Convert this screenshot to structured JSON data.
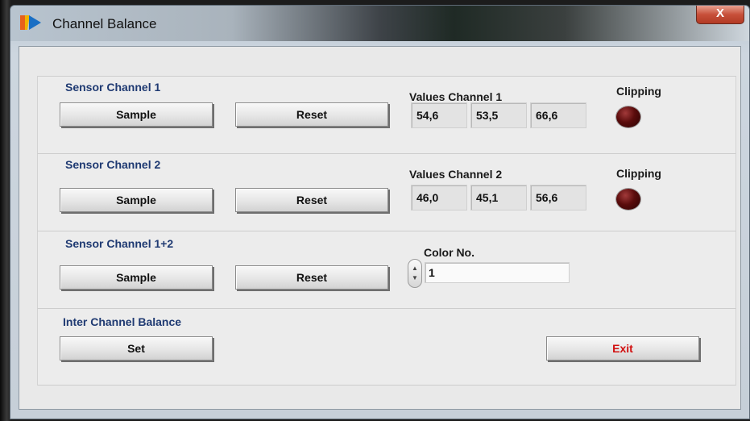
{
  "window": {
    "title": "Channel Balance",
    "close_label": "X"
  },
  "groups": {
    "channel1": {
      "title": "Sensor Channel 1",
      "sample_label": "Sample",
      "reset_label": "Reset",
      "values_label": "Values Channel 1",
      "values": [
        "54,6",
        "53,5",
        "66,6"
      ],
      "clipping_label": "Clipping"
    },
    "channel2": {
      "title": "Sensor Channel 2",
      "sample_label": "Sample",
      "reset_label": "Reset",
      "values_label": "Values Channel 2",
      "values": [
        "46,0",
        "45,1",
        "56,6"
      ],
      "clipping_label": "Clipping"
    },
    "channel12": {
      "title": "Sensor Channel 1+2",
      "sample_label": "Sample",
      "reset_label": "Reset",
      "color_label": "Color No.",
      "color_value": "1"
    },
    "inter": {
      "title": "Inter Channel Balance",
      "set_label": "Set",
      "exit_label": "Exit"
    }
  },
  "colors": {
    "group_title": "#1f3a72",
    "exit_text": "#d10f0f",
    "clipping_led_off": "#4a0808"
  },
  "icons": {
    "app": "labview-style-logo-icon",
    "spinner": "up-down-spinner-icon",
    "led": "clipping-indicator-led"
  }
}
